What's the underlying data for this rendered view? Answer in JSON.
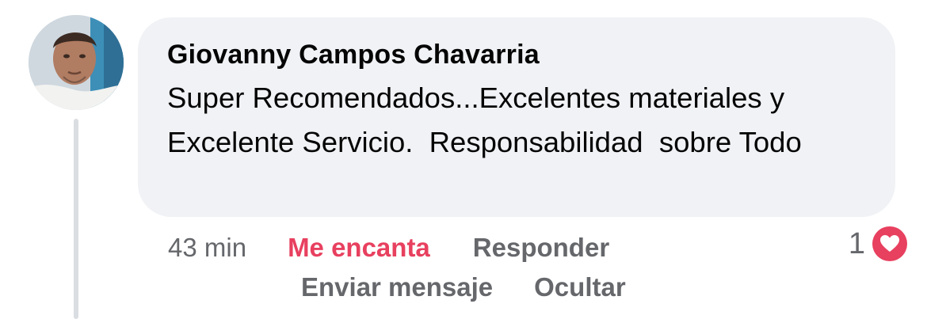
{
  "comment": {
    "author": "Giovanny Campos Chavarria",
    "text": "Super Recomendados...Excelentes materiales y Excelente Servicio.  Responsabilidad  sobre Todo"
  },
  "actions": {
    "time": "43 min",
    "reaction_label": "Me encanta",
    "reply_label": "Responder",
    "message_label": "Enviar mensaje",
    "hide_label": "Ocultar"
  },
  "reactions": {
    "count": "1",
    "type_icon": "heart-icon",
    "color": "#e8405f"
  },
  "colors": {
    "bubble": "#f0f2f5",
    "secondary_text": "#65676b",
    "love_accent": "#e8405f"
  }
}
